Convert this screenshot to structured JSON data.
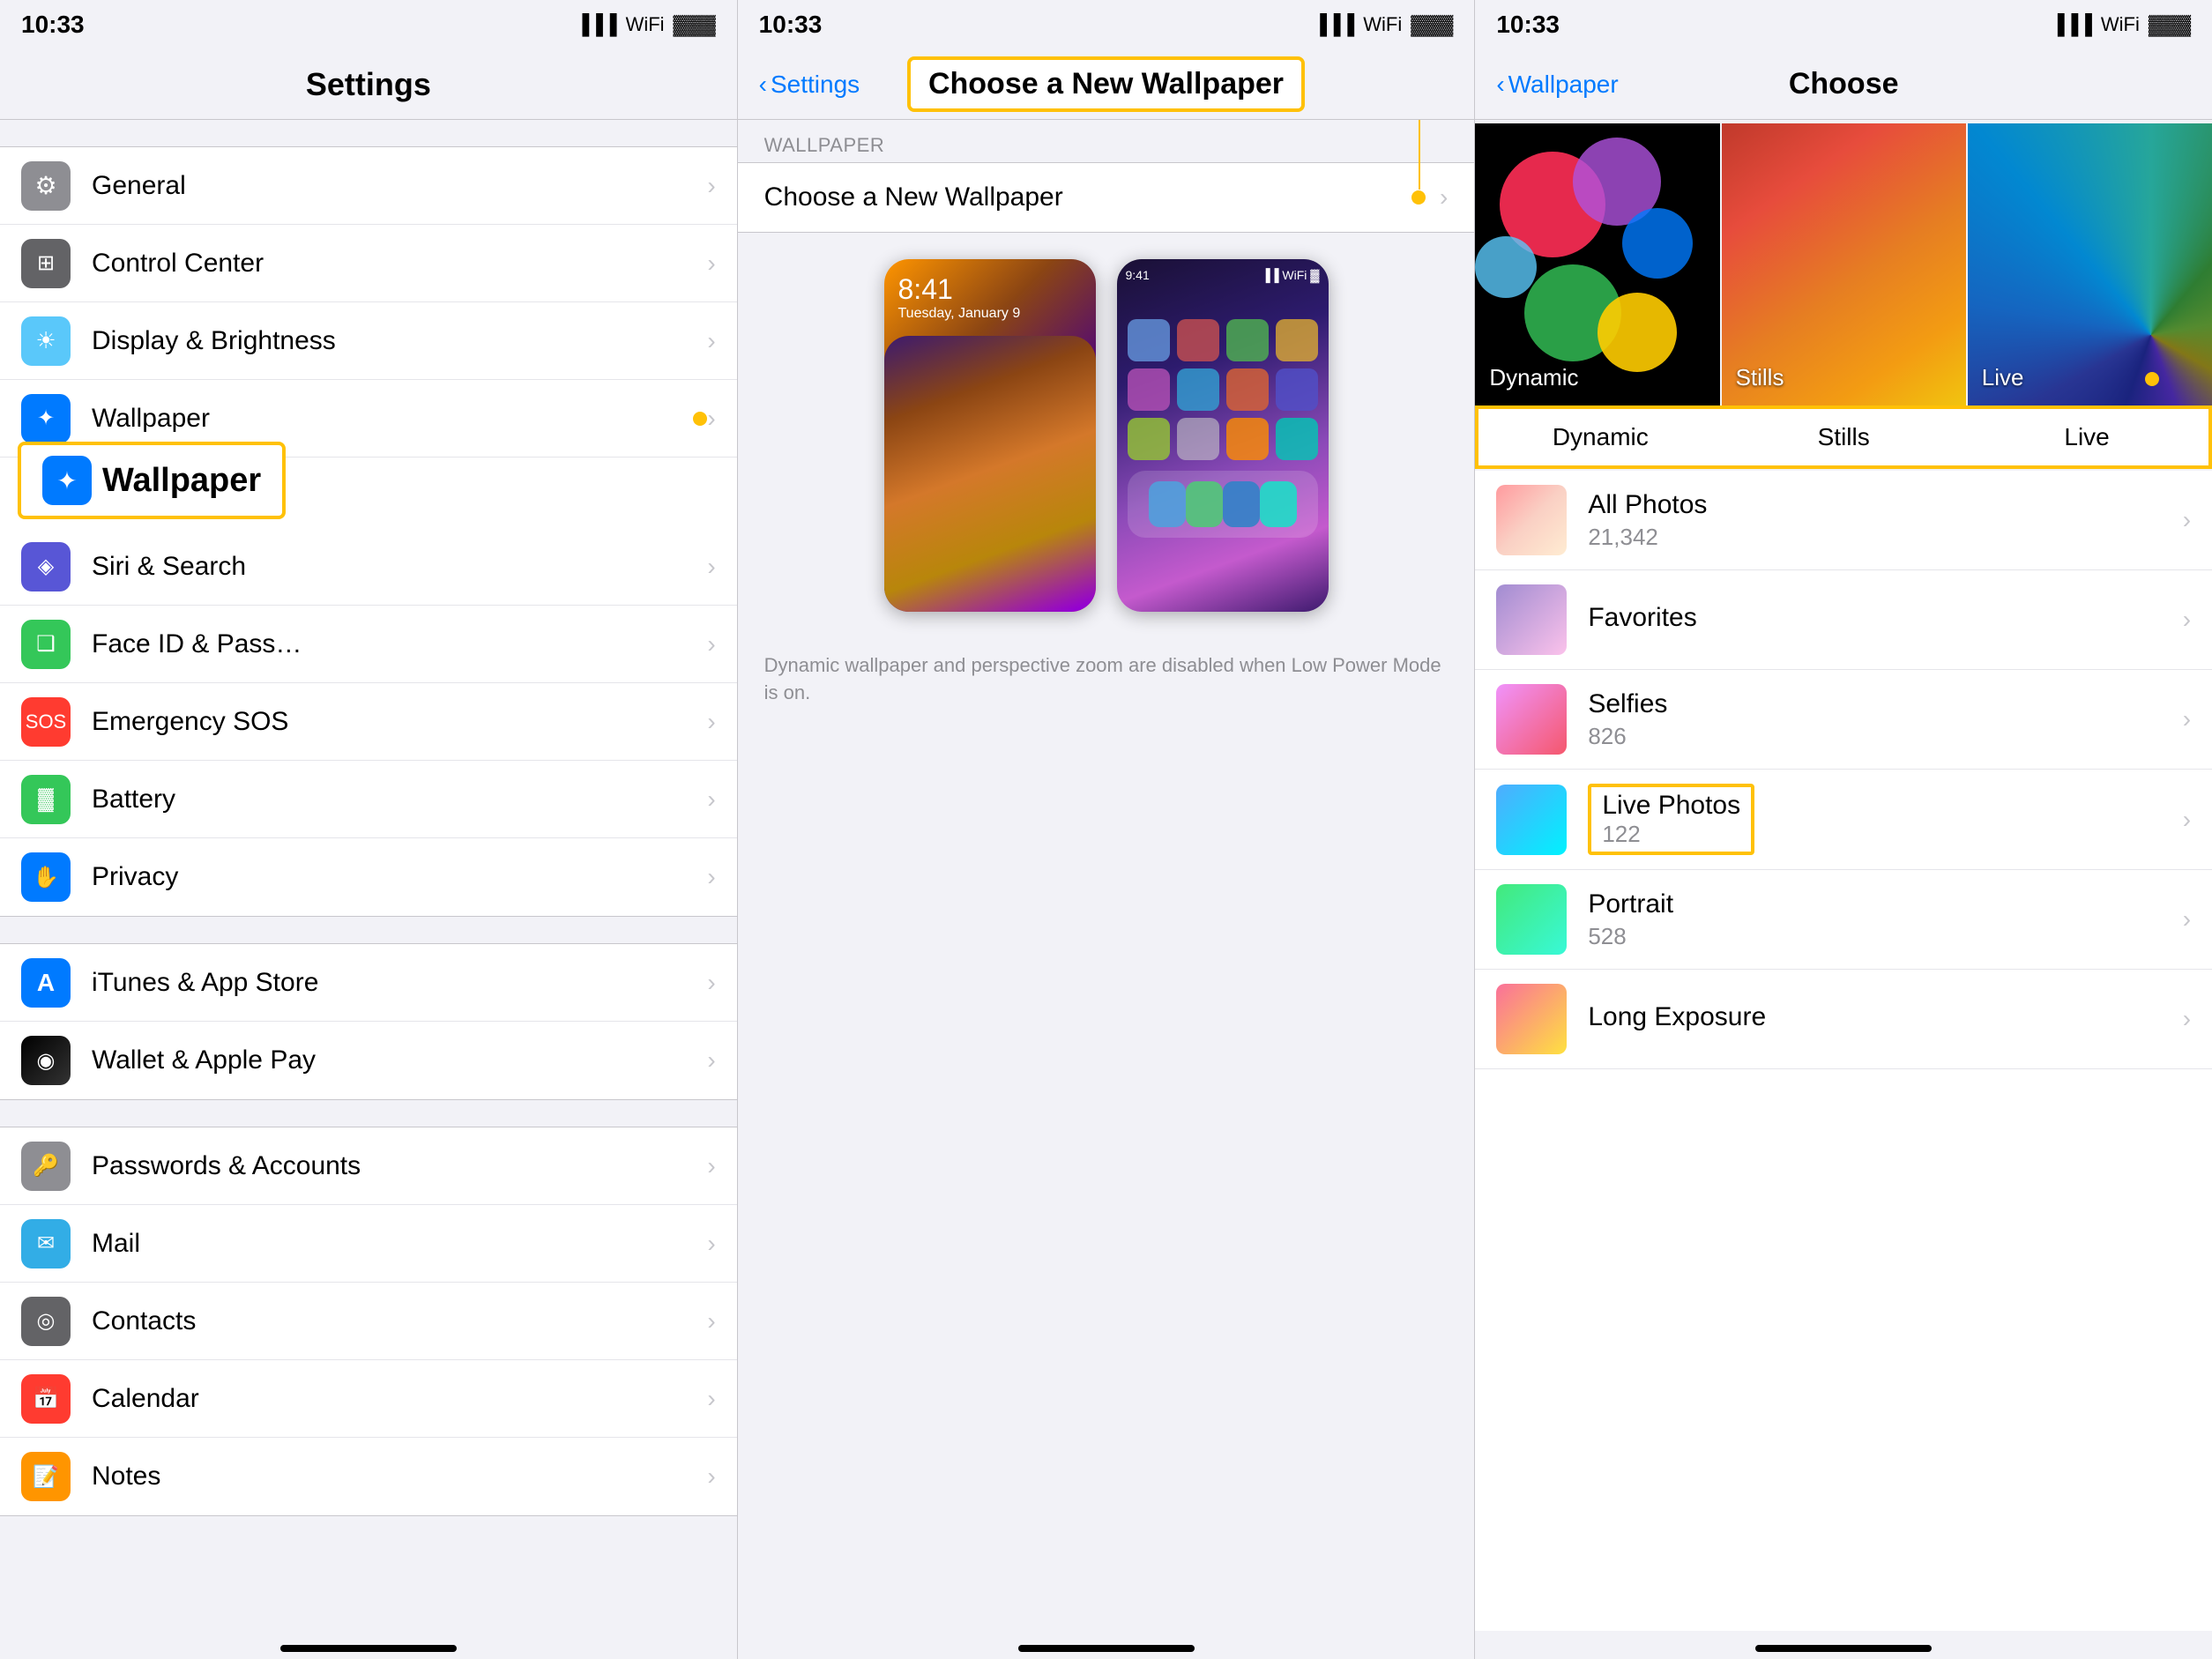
{
  "panel1": {
    "statusBar": {
      "time": "10:33",
      "arrow": "▲"
    },
    "navTitle": "Settings",
    "groups": [
      {
        "items": [
          {
            "id": "general",
            "label": "General",
            "iconColor": "icon-gray",
            "iconChar": "⚙",
            "hasChevron": true
          },
          {
            "id": "control-center",
            "label": "Control Center",
            "iconColor": "icon-gray2",
            "iconChar": "⊞",
            "hasChevron": true
          },
          {
            "id": "display-brightness",
            "label": "Display & Brightness",
            "iconColor": "icon-blue2",
            "iconChar": "☀",
            "hasChevron": true
          },
          {
            "id": "wallpaper",
            "label": "Wallpaper",
            "iconColor": "icon-blue",
            "iconChar": "✦",
            "hasDot": true,
            "hasChevron": true
          },
          {
            "id": "siri-search",
            "label": "Siri & Search",
            "iconColor": "icon-indigo",
            "iconChar": "◈",
            "hasChevron": true
          },
          {
            "id": "face-id",
            "label": "Face ID & Pass…",
            "iconColor": "icon-green",
            "iconChar": "❑",
            "hasChevron": true
          },
          {
            "id": "emergency-sos",
            "label": "Emergency SOS",
            "iconColor": "icon-red",
            "iconChar": "🆘",
            "hasChevron": true
          },
          {
            "id": "battery",
            "label": "Battery",
            "iconColor": "icon-green",
            "iconChar": "🔋",
            "hasChevron": true
          },
          {
            "id": "privacy",
            "label": "Privacy",
            "iconColor": "icon-blue",
            "iconChar": "✋",
            "hasChevron": true
          }
        ]
      },
      {
        "items": [
          {
            "id": "itunes",
            "label": "iTunes & App Store",
            "iconColor": "icon-blue",
            "iconChar": "A",
            "hasChevron": true
          },
          {
            "id": "wallet",
            "label": "Wallet & Apple Pay",
            "iconColor": "icon-teal",
            "iconChar": "◉",
            "hasChevron": true
          }
        ]
      },
      {
        "items": [
          {
            "id": "passwords",
            "label": "Passwords & Accounts",
            "iconColor": "icon-gray",
            "iconChar": "🔑",
            "hasChevron": true
          },
          {
            "id": "mail",
            "label": "Mail",
            "iconColor": "icon-lightblue",
            "iconChar": "✉",
            "hasChevron": true
          },
          {
            "id": "contacts",
            "label": "Contacts",
            "iconColor": "icon-gray2",
            "iconChar": "◎",
            "hasChevron": true
          },
          {
            "id": "calendar",
            "label": "Calendar",
            "iconColor": "icon-red",
            "iconChar": "📅",
            "hasChevron": true
          },
          {
            "id": "notes",
            "label": "Notes",
            "iconColor": "icon-orange",
            "iconChar": "📝",
            "hasChevron": true
          }
        ]
      }
    ],
    "annotations": {
      "wallpaperBox": {
        "label": "Wallpaper",
        "iconChar": "✦"
      }
    }
  },
  "panel2": {
    "statusBar": {
      "time": "10:33"
    },
    "navBack": "Settings",
    "navTitle": "Choose a New Wallpaper",
    "sectionHeader": "WALLPAPER",
    "chooseLabel": "Choose a New Wallpaper",
    "note": "Dynamic wallpaper and perspective zoom are disabled when Low Power Mode is on.",
    "annotationTitle": "Choose a New Wallpaper"
  },
  "panel3": {
    "statusBar": {
      "time": "10:33"
    },
    "navBack": "Wallpaper",
    "navTitle": "Choose",
    "categories": [
      {
        "id": "dynamic",
        "label": "Dynamic"
      },
      {
        "id": "stills",
        "label": "Stills"
      },
      {
        "id": "live",
        "label": "Live"
      }
    ],
    "annotationCategories": {
      "dynamic": "Dynamic",
      "stills": "Stills",
      "live": "Live"
    },
    "liveDot": true,
    "albums": [
      {
        "id": "all-photos",
        "name": "All Photos",
        "count": "21,342"
      },
      {
        "id": "favorites",
        "name": "Favorites",
        "count": ""
      },
      {
        "id": "selfies",
        "name": "Selfies",
        "count": "826"
      },
      {
        "id": "live-photos",
        "name": "Live Photos",
        "count": "122"
      },
      {
        "id": "portrait",
        "name": "Portrait",
        "count": "528"
      },
      {
        "id": "long-exposure",
        "name": "Long Exposure",
        "count": ""
      }
    ]
  }
}
